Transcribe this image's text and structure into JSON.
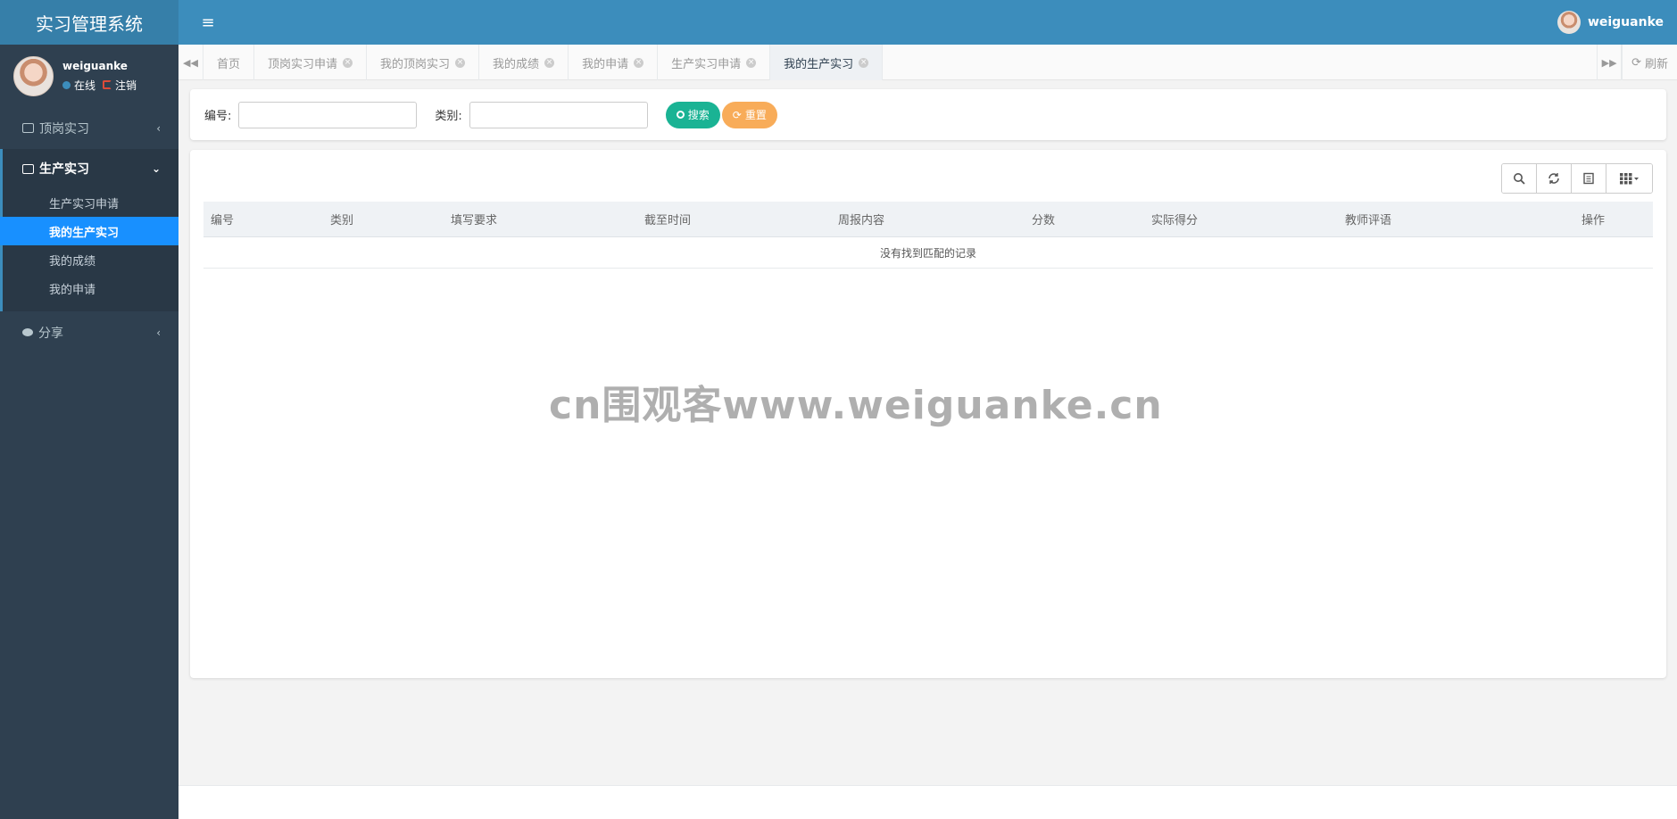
{
  "app": {
    "title": "实习管理系统"
  },
  "user": {
    "name": "weiguanke",
    "status": "在线",
    "logout": "注销"
  },
  "sidebar": {
    "groups": [
      {
        "label": "顶岗实习",
        "expanded": false
      },
      {
        "label": "生产实习",
        "expanded": true,
        "items": [
          "生产实习申请",
          "我的生产实习",
          "我的成绩",
          "我的申请"
        ],
        "active_item": "我的生产实习"
      },
      {
        "label": "分享",
        "expanded": false
      }
    ]
  },
  "header": {
    "user_name": "weiguanke"
  },
  "tabs": {
    "items": [
      {
        "label": "首页",
        "closable": false
      },
      {
        "label": "顶岗实习申请",
        "closable": true
      },
      {
        "label": "我的顶岗实习",
        "closable": true
      },
      {
        "label": "我的成绩",
        "closable": true
      },
      {
        "label": "我的申请",
        "closable": true
      },
      {
        "label": "生产实习申请",
        "closable": true
      },
      {
        "label": "我的生产实习",
        "closable": true,
        "active": true
      }
    ],
    "refresh_label": "刷新"
  },
  "search": {
    "field1_label": "编号:",
    "field2_label": "类别:",
    "search_btn": "搜索",
    "reset_btn": "重置"
  },
  "table": {
    "columns": [
      "编号",
      "类别",
      "填写要求",
      "截至时间",
      "周报内容",
      "分数",
      "实际得分",
      "教师评语",
      "操作"
    ],
    "empty_text": "没有找到匹配的记录"
  },
  "watermark": "cn围观客www.weiguanke.cn",
  "colors": {
    "header": "#3c8dbc",
    "sidebar": "#2f4050",
    "active_item": "#1890ff",
    "search_btn": "#1ab394",
    "reset_btn": "#f8ac59"
  }
}
